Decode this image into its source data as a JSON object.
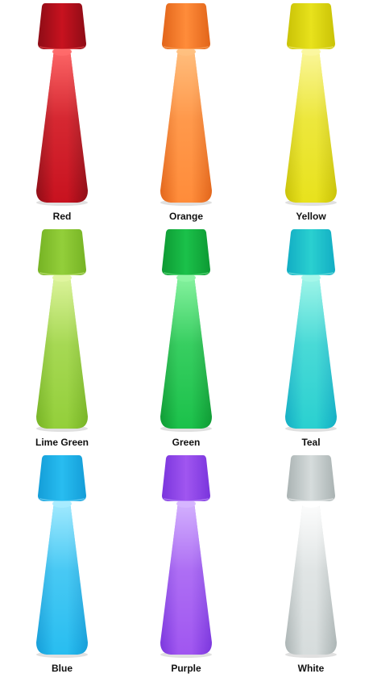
{
  "lamps": [
    {
      "label": "Red",
      "color": "#c8121f",
      "light": "#ff6a6a",
      "dark": "#8e0c16"
    },
    {
      "label": "Orange",
      "color": "#ff8c3a",
      "light": "#ffc080",
      "dark": "#e2651a"
    },
    {
      "label": "Yellow",
      "color": "#e8e21c",
      "light": "#fbf7a0",
      "dark": "#c9c206"
    },
    {
      "label": "Lime Green",
      "color": "#93cf3a",
      "light": "#e0f5a0",
      "dark": "#76b324"
    },
    {
      "label": "Green",
      "color": "#1bc14a",
      "light": "#8cf5a4",
      "dark": "#0d9a33"
    },
    {
      "label": "Teal",
      "color": "#2ad0d0",
      "light": "#a6f7ea",
      "dark": "#12adc4"
    },
    {
      "label": "Blue",
      "color": "#28bdf0",
      "light": "#a8ecff",
      "dark": "#149dd8"
    },
    {
      "label": "Purple",
      "color": "#a056f0",
      "light": "#d6b6ff",
      "dark": "#7a35dd"
    },
    {
      "label": "White",
      "color": "#d6dcdc",
      "light": "#ffffff",
      "dark": "#aab3b3"
    }
  ]
}
